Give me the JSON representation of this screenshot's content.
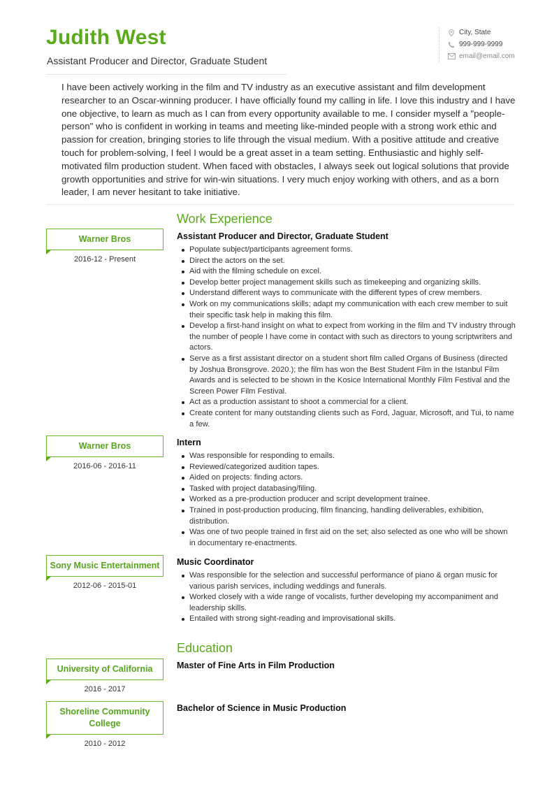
{
  "header": {
    "name": "Judith West",
    "headline": "Assistant Producer and Director, Graduate Student",
    "contact": {
      "location": "City, State",
      "phone": "999-999-9999",
      "email": "email@email.com"
    }
  },
  "summary": "I have been actively working in the film and TV industry as an executive assistant and film development researcher to an Oscar-winning producer. I have officially found my calling in life. I love this industry and I have one objective, to learn as much as I can from every opportunity available to me. I consider myself a \"people-person\" who is confident in working in teams and meeting like-minded people with a strong work ethic and passion for creation, bringing stories to life through the visual medium. With a positive attitude and creative touch for problem-solving, I feel I would be a great asset in a team setting. Enthusiastic and highly self-motivated film production student. When faced with obstacles, I always seek out logical solutions that provide growth opportunities and strive for win-win situations. I very much enjoy working with others, and as a born leader, I am never hesitant to take initiative.",
  "work": {
    "title": "Work Experience",
    "entries": [
      {
        "company": "Warner Bros",
        "dates": "2016-12 - Present",
        "role": "Assistant Producer and Director, Graduate Student",
        "bullets": [
          "Populate subject/participants agreement forms.",
          "Direct the actors on the set.",
          "Aid with the filming schedule on excel.",
          "Develop better project management skills such as timekeeping and organizing skills.",
          "Understand different ways to communicate with the different types of crew members.",
          "Work on my communications skills; adapt my communication with each crew member to suit their specific task help in making this film.",
          "Develop a first-hand insight on what to expect from working in the film and TV industry through the number of people I have come in contact with such as directors to young scriptwriters and actors.",
          "Serve as a first assistant director on a student short film called Organs of Business (directed by Joshua Bronsgrove. 2020.);  the film has won the Best Student Film in the Istanbul Film Awards and is selected to be shown in the Kosice International Monthly Film Festival and the Screen Power Film Festival.",
          "Act as a production assistant to shoot a commercial for a client.",
          "Create content for many outstanding clients such as Ford, Jaguar, Microsoft, and Tui, to name a few."
        ]
      },
      {
        "company": "Warner Bros",
        "dates": "2016-06 - 2016-11",
        "role": "Intern",
        "bullets": [
          "Was responsible for responding to emails.",
          "Reviewed/categorized audition tapes.",
          "Aided on projects: finding actors.",
          "Tasked with project databasing/filing.",
          "Worked as a pre-production producer and script development trainee.",
          "Trained in post-production producing, film financing, handling deliverables, exhibition, distribution.",
          "Was one of two people trained in first aid on the set; also selected as one who will be shown in documentary re-enactments."
        ]
      },
      {
        "company": "Sony Music Entertainment",
        "dates": "2012-06 - 2015-01",
        "role": "Music Coordinator",
        "bullets": [
          "Was responsible for the selection and successful performance of piano & organ music for various parish services, including weddings and funerals.",
          "Worked closely with a wide range of vocalists, further developing my accompaniment and leadership skills.",
          "Entailed with strong sight-reading and improvisational skills."
        ]
      }
    ]
  },
  "education": {
    "title": "Education",
    "entries": [
      {
        "school": "University of California",
        "dates": "2016 - 2017",
        "degree": "Master of Fine Arts in Film Production"
      },
      {
        "school": "Shoreline Community College",
        "dates": "2010 - 2012",
        "degree": "Bachelor of Science in Music Production"
      }
    ]
  },
  "colors": {
    "accent": "#5aab1a",
    "text": "#2b2b2b"
  }
}
